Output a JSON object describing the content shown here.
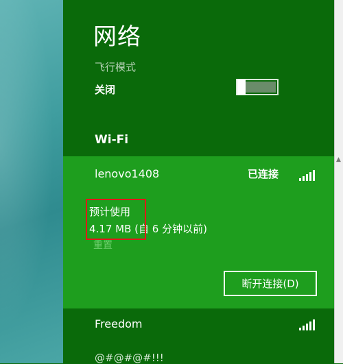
{
  "panel": {
    "title": "网络",
    "airplane_mode": {
      "label": "飞行模式",
      "state": "关闭"
    },
    "wifi_section": "Wi-Fi"
  },
  "networks": [
    {
      "name": "lenovo1408",
      "status": "已连接",
      "usage_label": "预计使用",
      "usage_value": "4.17 MB",
      "usage_note": " (自 6 分钟以前)",
      "reset_label": "重置",
      "disconnect_label": "断开连接(D)"
    },
    {
      "name": "Freedom"
    },
    {
      "name": "@#@#@#!!!"
    }
  ],
  "scrollbar": {
    "arrow": "▲"
  },
  "colors": {
    "panel_bg": "#0a6a0a",
    "selected_bg": "#1e9e1e",
    "highlight": "#e01818",
    "reset_text": "#6ed06e"
  },
  "icons": [
    "wifi-signal-icon",
    "wifi-signal-icon"
  ]
}
